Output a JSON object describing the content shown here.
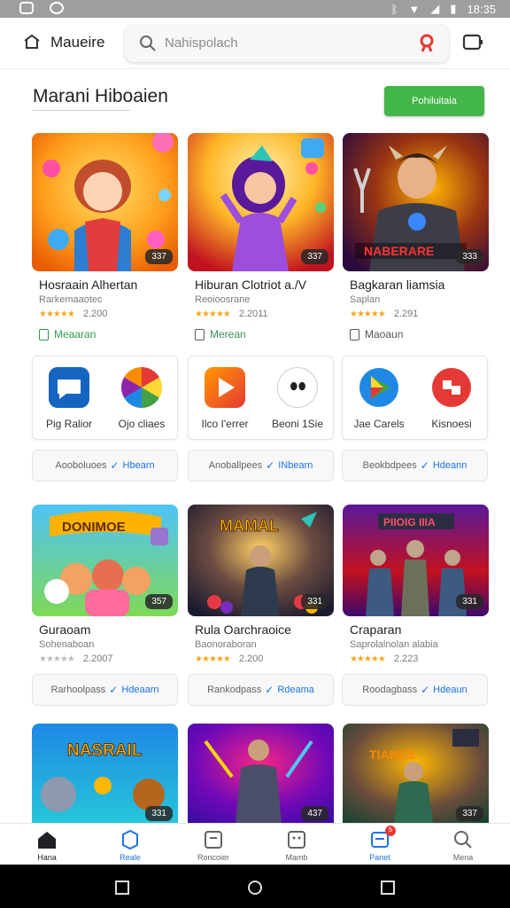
{
  "status_bar": {
    "time": "18:35"
  },
  "header": {
    "brand": "Maueire",
    "search_placeholder": "Nahispolach"
  },
  "section": {
    "title": "Marani Hiboaien",
    "button": "Pohiluitaia"
  },
  "featured": [
    {
      "title": "Hosraain Alhertan",
      "subtitle": "Rarkemaaotec",
      "rating": "2.200",
      "install": "Meaaran",
      "score": "337",
      "stars": 5
    },
    {
      "title": "Hiburan Clotriot a./V",
      "subtitle": "Reoioosrane",
      "rating": "2.2011",
      "install": "Merean",
      "score": "337",
      "stars": 5
    },
    {
      "title": "Bagkaran liamsia",
      "subtitle": "Saplan",
      "rating": "2.291",
      "install": "Maoaun",
      "score": "333",
      "stars": 5
    }
  ],
  "mini_apps": [
    {
      "label": "Pig Ralior",
      "icon": "chat-bubble-icon"
    },
    {
      "label": "Ojo cliaes",
      "icon": "color-wheel-icon"
    },
    {
      "label": "Ilco I'errer",
      "icon": "play-triangle-icon"
    },
    {
      "label": "Beoni 1Sie",
      "icon": "face-icon"
    },
    {
      "label": "Jae Carels",
      "icon": "play-store-icon"
    },
    {
      "label": "Kisnoesi",
      "icon": "badge-icon"
    }
  ],
  "chips_row1": [
    {
      "text": "Aooboluoes",
      "link": "Hbearn"
    },
    {
      "text": "Anoballpees",
      "link": "INbearn"
    },
    {
      "text": "Beokbdpees",
      "link": "Hdeann"
    }
  ],
  "grid2": [
    {
      "title": "Guraoam",
      "subtitle": "Sohenaboan",
      "rating": "2.2007",
      "score": "357",
      "stars_grey": true
    },
    {
      "title": "Rula Oarchraoice",
      "subtitle": "Baonoraboran",
      "rating": "2.200",
      "score": "331"
    },
    {
      "title": "Craparan",
      "subtitle": "Saprolalnolan alabia",
      "rating": "2.223",
      "score": "331"
    }
  ],
  "chips_row2": [
    {
      "text": "Rarhoolpass",
      "link": "Hdeaarn"
    },
    {
      "text": "Rankodpass",
      "link": "Rdeama"
    },
    {
      "text": "Roodagbass",
      "link": "Hdeaun"
    }
  ],
  "grid3": [
    {
      "score": "331"
    },
    {
      "score": "437"
    },
    {
      "score": "337"
    }
  ],
  "bottom_nav": [
    {
      "label": "Hana"
    },
    {
      "label": "Reale"
    },
    {
      "label": "Roncoier"
    },
    {
      "label": "Mamb"
    },
    {
      "label": "Panet",
      "badge": "5"
    },
    {
      "label": "Mena"
    }
  ],
  "colors": {
    "accent": "#43b649",
    "link": "#1a73e8",
    "star": "#f4a81d"
  }
}
